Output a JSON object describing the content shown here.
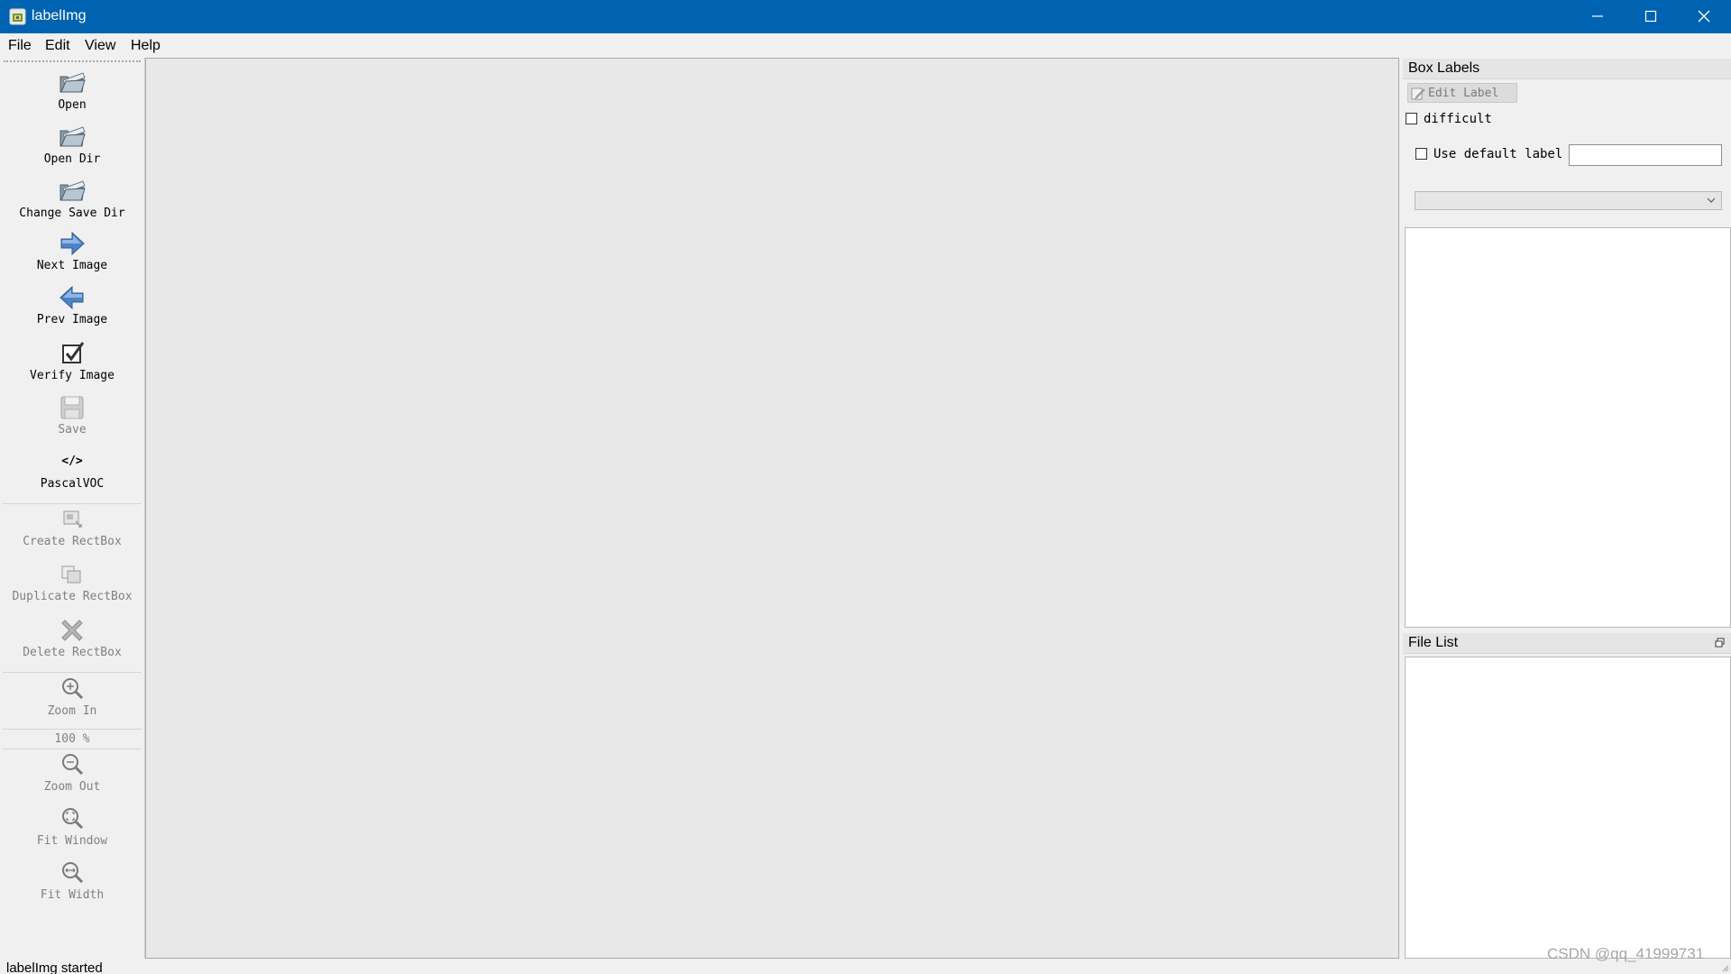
{
  "window": {
    "title": "labelImg",
    "icon": "labelimg-app-icon",
    "controls": [
      "minimize-icon",
      "maximize-icon",
      "close-icon"
    ]
  },
  "menu": {
    "items": [
      {
        "label": "File"
      },
      {
        "label": "Edit"
      },
      {
        "label": "View"
      },
      {
        "label": "Help"
      }
    ]
  },
  "toolbar": {
    "open": {
      "label": "Open",
      "icon": "folder-open-icon",
      "enabled": true
    },
    "open_dir": {
      "label": "Open Dir",
      "icon": "folder-open-icon",
      "enabled": true
    },
    "change_save_dir": {
      "label": "Change Save Dir",
      "icon": "folder-open-icon",
      "enabled": true
    },
    "next_image": {
      "label": "Next Image",
      "icon": "arrow-right-icon",
      "enabled": true
    },
    "prev_image": {
      "label": "Prev Image",
      "icon": "arrow-left-icon",
      "enabled": true
    },
    "verify_image": {
      "label": "Verify Image",
      "icon": "checkbox-checked-icon",
      "enabled": true
    },
    "save": {
      "label": "Save",
      "icon": "floppy-disk-icon",
      "enabled": false
    },
    "format": {
      "label": "PascalVOC",
      "icon_text": "</>",
      "icon": "code-icon",
      "enabled": true
    },
    "create_rectbox": {
      "label": "Create RectBox",
      "icon": "create-rect-icon",
      "enabled": false
    },
    "duplicate_rectbox": {
      "label": "Duplicate RectBox",
      "icon": "duplicate-icon",
      "enabled": false
    },
    "delete_rectbox": {
      "label": "Delete RectBox",
      "icon": "delete-x-icon",
      "enabled": false
    },
    "zoom_in": {
      "label": "Zoom In",
      "icon": "zoom-in-icon",
      "enabled": false
    },
    "zoom_value": "100 %",
    "zoom_out": {
      "label": "Zoom Out",
      "icon": "zoom-out-icon",
      "enabled": false
    },
    "fit_window": {
      "label": "Fit Window",
      "icon": "fit-window-icon",
      "enabled": false
    },
    "fit_width": {
      "label": "Fit Width",
      "icon": "fit-width-icon",
      "enabled": false
    }
  },
  "box_labels": {
    "title": "Box Labels",
    "edit_label": "Edit Label",
    "difficult": {
      "label": "difficult",
      "checked": false
    },
    "use_default_label": {
      "label": "Use default label",
      "checked": false
    },
    "default_label_value": "",
    "combo_value": ""
  },
  "file_list": {
    "title": "File List"
  },
  "status": {
    "text": "labelImg started"
  },
  "watermark": "CSDN @qq_41999731",
  "colors": {
    "titlebar": "#0063b1",
    "background": "#f0f0f0",
    "canvas": "#e8e8e8",
    "disabled_text": "#808080"
  }
}
